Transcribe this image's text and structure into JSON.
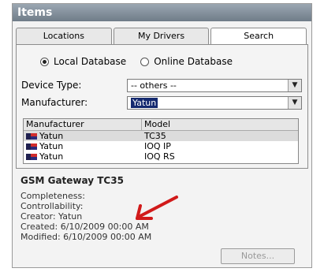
{
  "window": {
    "title": "Items"
  },
  "tabs": [
    {
      "label": "Locations"
    },
    {
      "label": "My Drivers"
    },
    {
      "label": "Search"
    }
  ],
  "search": {
    "source_options": [
      {
        "label": "Local Database",
        "selected": true
      },
      {
        "label": "Online Database",
        "selected": false
      }
    ],
    "device_type": {
      "label": "Device Type:",
      "value": "-- others --"
    },
    "manufacturer": {
      "label": "Manufacturer:",
      "value": "Yatun"
    }
  },
  "results": {
    "columns": [
      "Manufacturer",
      "Model"
    ],
    "rows": [
      {
        "manufacturer": "Yatun",
        "model": "TC35"
      },
      {
        "manufacturer": "Yatun",
        "model": "IOQ IP"
      },
      {
        "manufacturer": "Yatun",
        "model": "IOQ RS"
      }
    ]
  },
  "details": {
    "title": "GSM Gateway TC35",
    "completeness": "Completeness:",
    "controllability": "Controllability:",
    "creator": "Creator: Yatun",
    "created": "Created: 6/10/2009 00:00 AM",
    "modified": "Modified: 6/10/2009 00:00 AM"
  },
  "buttons": {
    "notes_label": "Notes..."
  },
  "colors": {
    "selection": "#14296f",
    "annotation_arrow": "#d11a1a"
  }
}
